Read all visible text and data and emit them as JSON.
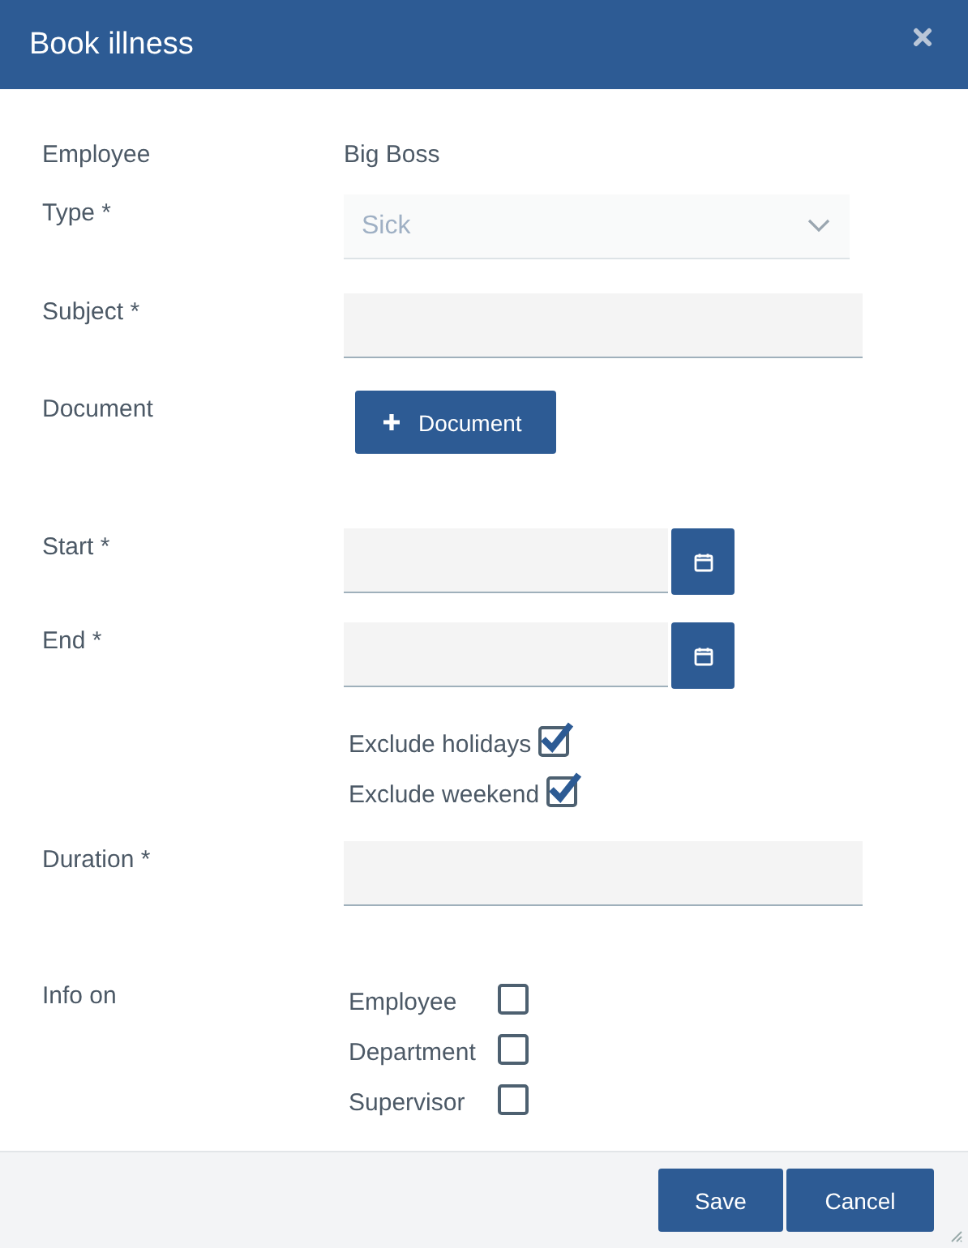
{
  "dialog": {
    "title": "Book illness"
  },
  "fields": [
    {
      "kind": "static",
      "label": "Employee",
      "value": "Big Boss"
    },
    {
      "kind": "select",
      "label": "Type *",
      "value": "Sick",
      "disabled": true
    },
    {
      "kind": "text",
      "label": "Subject *"
    },
    {
      "kind": "button",
      "label": "Document",
      "button": "Document"
    },
    {
      "kind": "date",
      "label": "Start *"
    },
    {
      "kind": "date",
      "label": "End *"
    },
    {
      "kind": "options",
      "options": [
        {
          "label": "Exclude holidays",
          "checked": true
        },
        {
          "label": "Exclude weekend",
          "checked": true
        }
      ]
    },
    {
      "kind": "text",
      "label": "Duration *"
    },
    {
      "kind": "options",
      "label": "Info on",
      "options": [
        {
          "label": "Employee",
          "checked": false
        },
        {
          "label": "Department",
          "checked": false
        },
        {
          "label": "Supervisor",
          "checked": false
        }
      ]
    }
  ],
  "buttons": [
    "Save",
    "Cancel"
  ]
}
